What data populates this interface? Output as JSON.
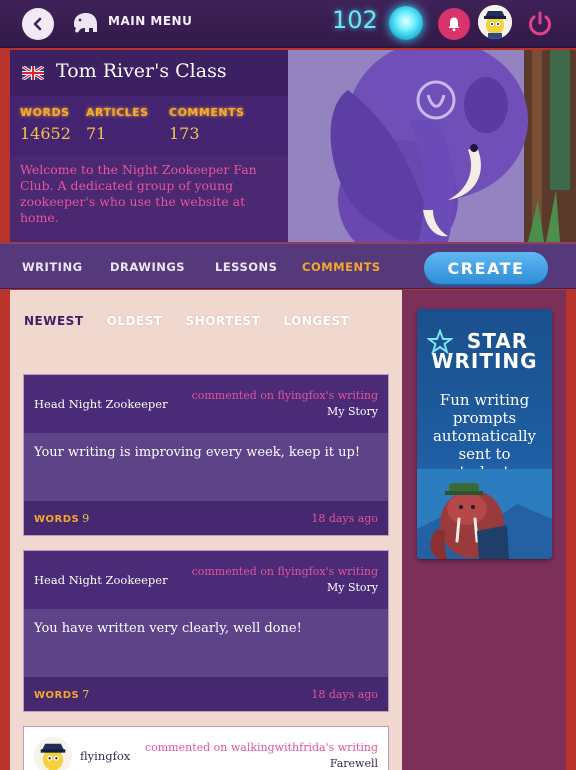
{
  "topbar": {
    "back_icon": "chevron-left-icon",
    "menu_label": "MAIN MENU",
    "stars_count": "102",
    "orb_icon": "glowing-orb-icon",
    "bell_icon": "bell-icon",
    "power_icon": "power-icon"
  },
  "class": {
    "flag_icon": "uk-flag-icon",
    "name": "Tom River's Class",
    "stats": [
      {
        "label": "WORDS",
        "value": "14652"
      },
      {
        "label": "ARTICLES",
        "value": "71"
      },
      {
        "label": "COMMENTS",
        "value": "173"
      }
    ],
    "description": "Welcome to the Night Zookeeper Fan Club. A dedicated group of young zookeeper's who use the website at home."
  },
  "tabs": [
    {
      "label": "WRITING",
      "active": false
    },
    {
      "label": "DRAWINGS",
      "active": false
    },
    {
      "label": "LESSONS",
      "active": false
    },
    {
      "label": "COMMENTS",
      "active": true
    }
  ],
  "create_label": "CREATE",
  "sort": {
    "options": [
      "NEWEST",
      "OLDEST",
      "SHORTEST",
      "LONGEST"
    ],
    "active": "NEWEST"
  },
  "comments": [
    {
      "author": "Head Night Zookeeper",
      "commented_on": "commented on flyingfox's writing",
      "work_title": "My Story",
      "text": "Your writing is improving every week, keep it up!",
      "words_label": "WORDS",
      "words": "9",
      "date": "18 days ago"
    },
    {
      "author": "Head Night Zookeeper",
      "commented_on": "commented on flyingfox's writing",
      "work_title": "My Story",
      "text": "You have written very clearly, well done!",
      "words_label": "WORDS",
      "words": "7",
      "date": "18 days ago"
    },
    {
      "author": "flyingfox",
      "commented_on": "commented on walkingwithfrida's writing",
      "work_title": "Farewell"
    }
  ],
  "promo": {
    "logo_line1": "STAR",
    "logo_line2": "WRITING",
    "text": "Fun writing prompts automatically sent to students"
  },
  "colors": {
    "topbar": "#3f2258",
    "panel": "#4a2872",
    "accent_orange": "#f5a82c",
    "accent_pink": "#e05599",
    "create_blue": "#3fa0e4",
    "stars_cyan": "#6ee7f3"
  }
}
